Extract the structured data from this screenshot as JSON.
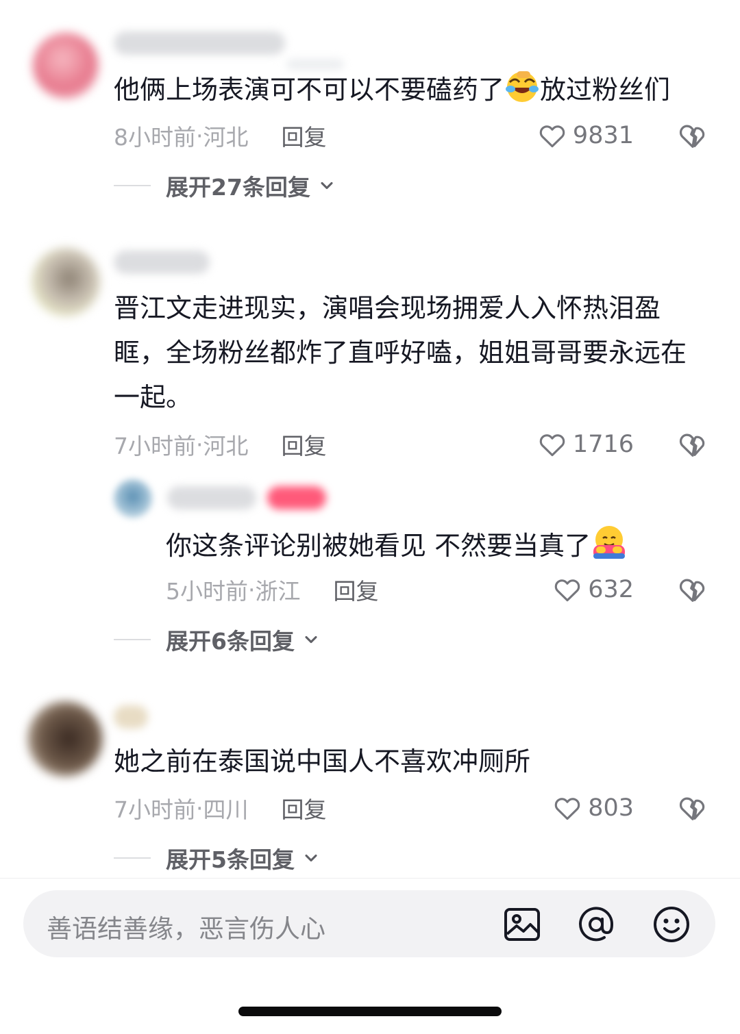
{
  "comments": [
    {
      "text": "他俩上场表演可不可以不要磕药了",
      "text_after_emoji": "放过粉丝们",
      "emoji": "face-with-tears-of-joy-icon",
      "time": "8小时前",
      "location": "河北",
      "reply_label": "回复",
      "likes": "9831",
      "expand_label": "展开27条回复"
    },
    {
      "text": "晋江文走进现实，演唱会现场拥爱人入怀热泪盈眶，全场粉丝都炸了直呼好嗑，姐姐哥哥要永远在一起。",
      "time": "7小时前",
      "location": "河北",
      "reply_label": "回复",
      "likes": "1716",
      "sub_reply": {
        "text": "你这条评论别被她看见 不然要当真了",
        "emoji": "hugging-face-icon",
        "time": "5小时前",
        "location": "浙江",
        "reply_label": "回复",
        "likes": "632"
      },
      "expand_label": "展开6条回复"
    },
    {
      "text": "她之前在泰国说中国人不喜欢冲厕所",
      "time": "7小时前",
      "location": "四川",
      "reply_label": "回复",
      "likes": "803",
      "expand_label": "展开5条回复"
    }
  ],
  "composer": {
    "placeholder": "善语结善缘，恶言伤人心"
  },
  "separator": " · ",
  "colors": {
    "text": "#161823",
    "meta": "#a7a8ad",
    "muted": "#5f6066",
    "input_bg": "#f2f2f4"
  }
}
